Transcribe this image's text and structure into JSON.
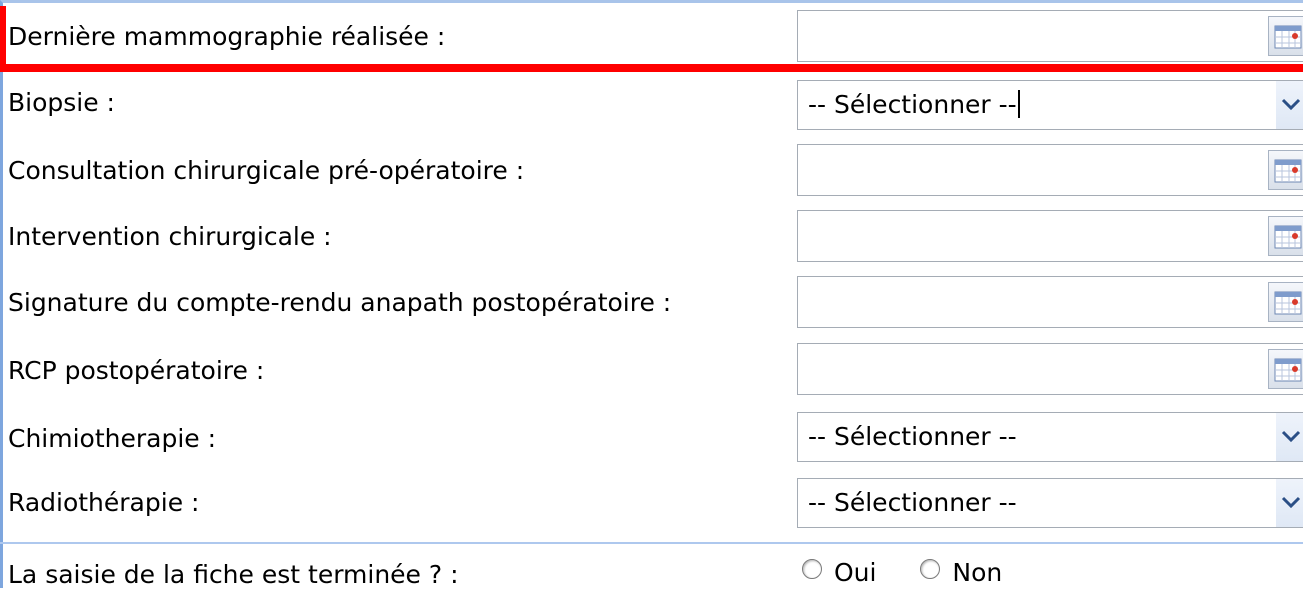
{
  "form": {
    "rows": [
      {
        "label": "Dernière mammographie réalisée :",
        "type": "date",
        "value": ""
      },
      {
        "label": "Biopsie :",
        "type": "select",
        "value": "-- Sélectionner --"
      },
      {
        "label": "Consultation chirurgicale pré-opératoire :",
        "type": "date",
        "value": ""
      },
      {
        "label": "Intervention chirurgicale :",
        "type": "date",
        "value": ""
      },
      {
        "label": "Signature du compte-rendu anapath postopératoire :",
        "type": "date",
        "value": ""
      },
      {
        "label": "RCP postopératoire :",
        "type": "date",
        "value": ""
      },
      {
        "label": "Chimiotherapie :",
        "type": "select",
        "value": "-- Sélectionner --"
      },
      {
        "label": "Radiothérapie :",
        "type": "select",
        "value": "-- Sélectionner --"
      }
    ],
    "completion": {
      "label": "La saisie de la fiche est terminée ? :",
      "options": [
        "Oui",
        "Non"
      ]
    }
  },
  "icons": {
    "date_button": "calendar-icon",
    "select_button": "chevron-down-icon"
  },
  "colors": {
    "highlight": "#ff0000",
    "frame_border": "#7ea6de",
    "field_border": "#a5acb5",
    "chevron": "#2b4f86"
  }
}
